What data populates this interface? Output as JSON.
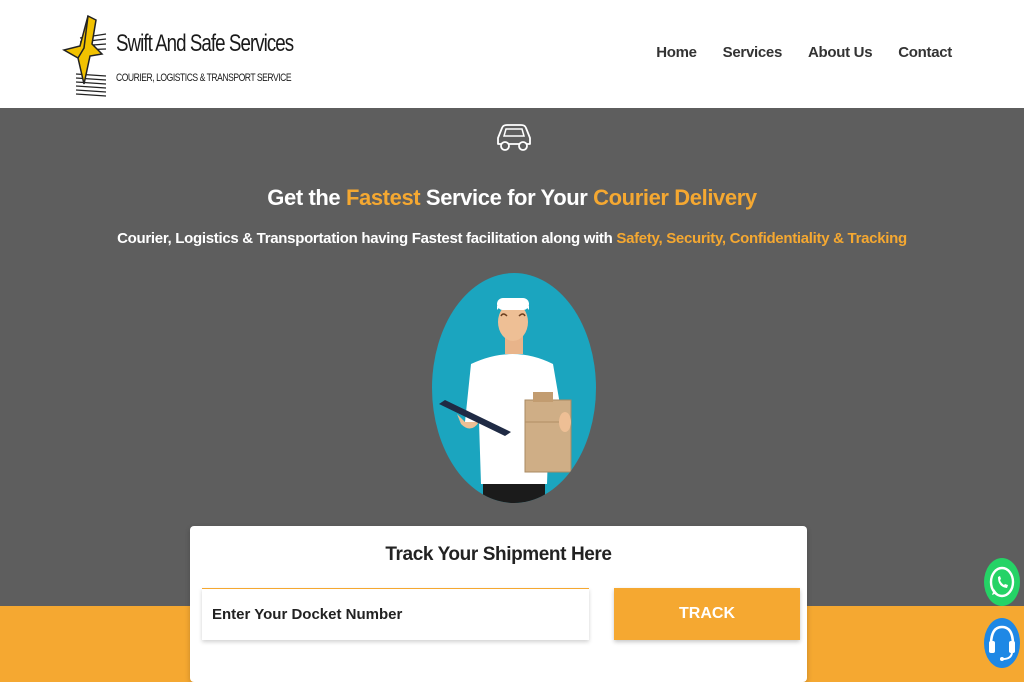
{
  "brand": {
    "name": "Swift And Safe Services",
    "tagline": "COURIER, LOGISTICS & TRANSPORT SERVICE",
    "logo_icon": "bird-logo-icon"
  },
  "nav": {
    "items": [
      {
        "label": "Home"
      },
      {
        "label": "Services"
      },
      {
        "label": "About Us"
      },
      {
        "label": "Contact"
      }
    ]
  },
  "hero": {
    "icon": "car-icon",
    "title_part1": "Get the ",
    "title_accent1": "Fastest",
    "title_part2": " Service for Your ",
    "title_accent2": "Courier Delivery",
    "subtitle_plain": "Courier, Logistics & Transportation having Fastest facilitation along with ",
    "subtitle_accent": "Safety, Security, Confidentiality & Tracking",
    "illustration": "delivery-man-illustration"
  },
  "track": {
    "title": "Track Your Shipment Here",
    "input_placeholder": "Enter Your Docket Number",
    "input_value": "",
    "button_label": "TRACK"
  },
  "floating": {
    "whatsapp_icon": "whatsapp-icon",
    "support_icon": "headset-support-icon"
  },
  "colors": {
    "accent": "#f5a831",
    "hero_bg": "#5e5e5e",
    "whatsapp": "#25d366",
    "support": "#1e88e5"
  }
}
